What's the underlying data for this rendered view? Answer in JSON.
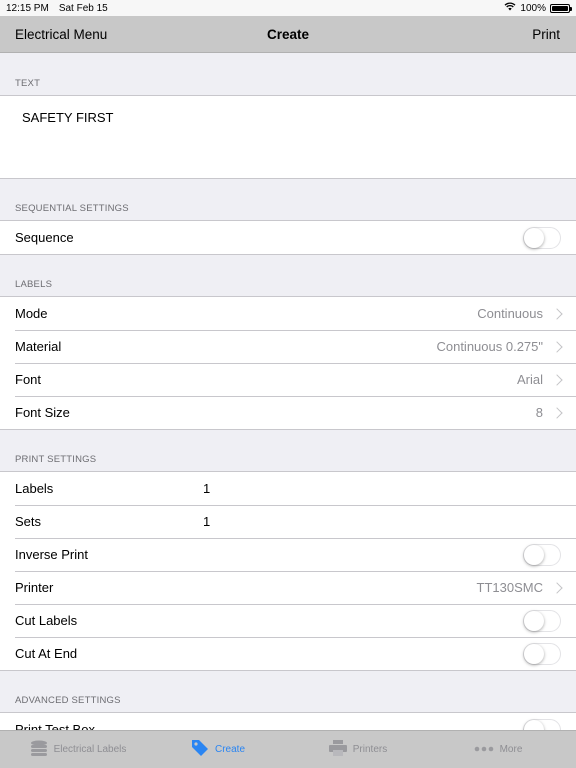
{
  "status_bar": {
    "time": "12:15 PM",
    "date": "Sat Feb 15",
    "battery": "100%"
  },
  "nav": {
    "back_label": "Electrical Menu",
    "title": "Create",
    "action_label": "Print"
  },
  "text_section": {
    "header": "TEXT",
    "value": "SAFETY FIRST"
  },
  "sequential": {
    "header": "SEQUENTIAL SETTINGS",
    "sequence_label": "Sequence",
    "sequence_on": false
  },
  "labels": {
    "header": "LABELS",
    "rows": [
      {
        "label": "Mode",
        "value": "Continuous"
      },
      {
        "label": "Material",
        "value": "Continuous 0.275\""
      },
      {
        "label": "Font",
        "value": "Arial"
      },
      {
        "label": "Font Size",
        "value": "8"
      }
    ]
  },
  "print_settings": {
    "header": "PRINT SETTINGS",
    "labels_label": "Labels",
    "labels_value": "1",
    "sets_label": "Sets",
    "sets_value": "1",
    "inverse_label": "Inverse Print",
    "inverse_on": false,
    "printer_label": "Printer",
    "printer_value": "TT130SMC",
    "cut_labels_label": "Cut Labels",
    "cut_labels_on": false,
    "cut_end_label": "Cut At End",
    "cut_end_on": false
  },
  "advanced": {
    "header": "ADVANCED SETTINGS",
    "test_box_label": "Print Test Box",
    "test_box_on": false
  },
  "tabs": [
    {
      "label": "Electrical Labels",
      "icon": "stack-icon",
      "active": false
    },
    {
      "label": "Create",
      "icon": "tag-icon",
      "active": true
    },
    {
      "label": "Printers",
      "icon": "printer-icon",
      "active": false
    },
    {
      "label": "More",
      "icon": "more-dots-icon",
      "active": false
    }
  ],
  "colors": {
    "accent": "#2a85f2",
    "nav_bg": "#c8c8c8",
    "grouped_bg": "#efeff4",
    "secondary_text": "#8e8e93"
  }
}
